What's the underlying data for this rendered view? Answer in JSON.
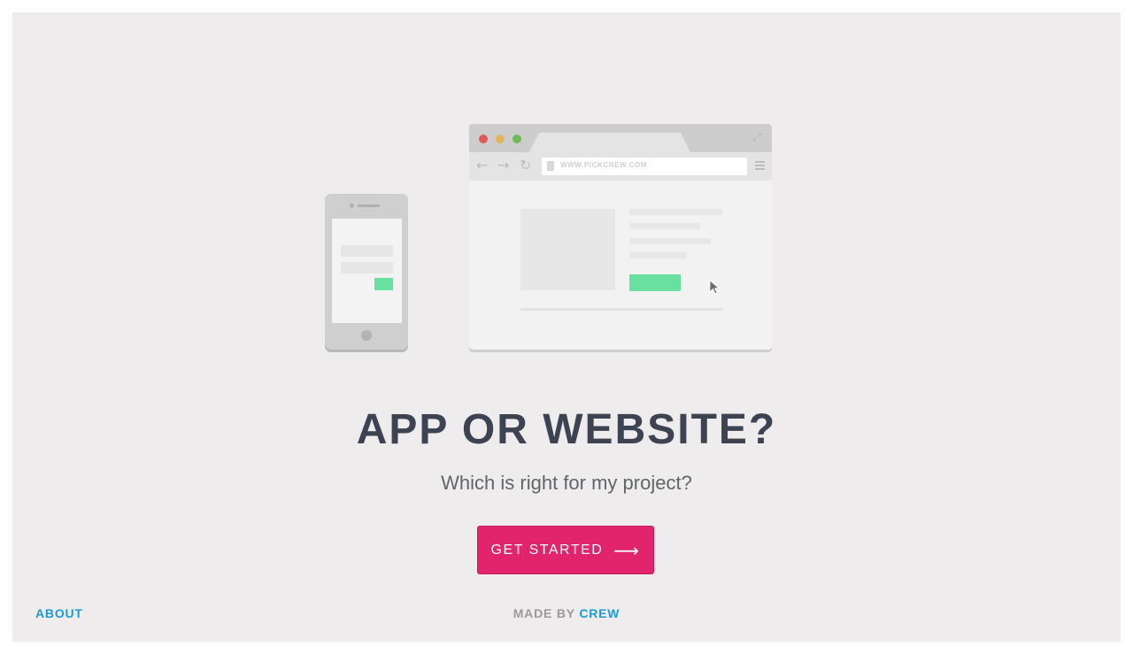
{
  "hero": {
    "title": "APP OR WEBSITE?",
    "subtitle": "Which is right for my project?",
    "cta_label": "GET STARTED",
    "cta_arrow": "⟶",
    "cta_color": "#e1246c"
  },
  "illustration": {
    "browser_url": "WWW.PICKCREW.COM",
    "accent_green": "#68e1a0"
  },
  "footer": {
    "about_label": "ABOUT",
    "made_by_prefix": "MADE BY",
    "made_by_link": "CREW",
    "link_color": "#1d9bd6"
  }
}
